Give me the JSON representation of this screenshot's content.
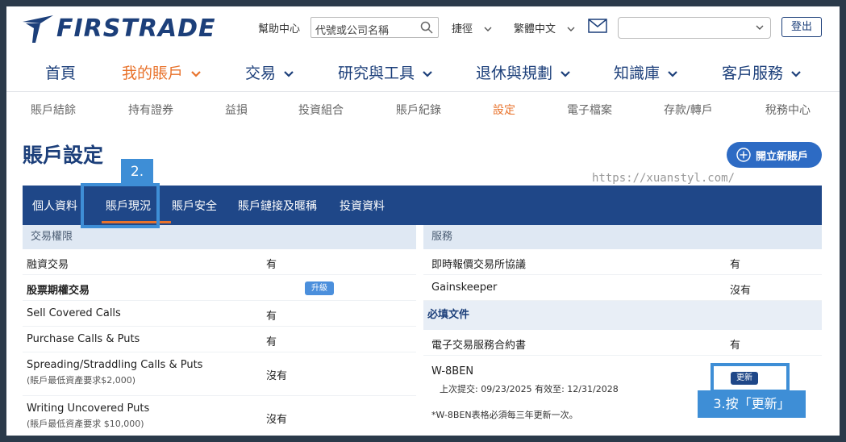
{
  "brand": {
    "logo_text": "FIRSTRADE",
    "color": "#1c3f7a"
  },
  "topbar": {
    "help": "幫助中心",
    "search_placeholder": "代號或公司名稱",
    "quick": "捷徑",
    "language": "繁體中文",
    "account_value": "",
    "logout": "登出"
  },
  "mainnav": [
    {
      "label": "首頁"
    },
    {
      "label": "我的賬戶",
      "active": true
    },
    {
      "label": "交易"
    },
    {
      "label": "研究與工具"
    },
    {
      "label": "退休與規劃"
    },
    {
      "label": "知識庫"
    },
    {
      "label": "客戶服務"
    }
  ],
  "subnav": [
    "賬戶結餘",
    "持有證券",
    "益損",
    "投資組合",
    "賬戶紀錄",
    "設定",
    "電子檔案",
    "存款/轉戶",
    "稅務中心"
  ],
  "subnav_active": "設定",
  "page": {
    "title": "賬戶設定",
    "open_account": "開立新賬戶",
    "watermark": "https://xuanstyl.com/"
  },
  "annotations": {
    "step2": "2.",
    "step3": "3.按「更新」"
  },
  "tabs": [
    "個人資料",
    "賬戶現況",
    "賬戶安全",
    "賬戶鏈接及暱稱",
    "投資資料"
  ],
  "active_tab": "賬戶現況",
  "trading_permissions": {
    "header": "交易權限",
    "rows": [
      {
        "label": "融資交易",
        "value": "有"
      },
      {
        "label": "股票期權交易",
        "value": "",
        "badge": "升級"
      },
      {
        "label": "Sell Covered Calls",
        "value": "有"
      },
      {
        "label": "Purchase Calls & Puts",
        "value": "有"
      },
      {
        "label": "Spreading/Straddling Calls & Puts",
        "note": "(賬戶最低資產要求$2,000)",
        "value": "沒有"
      },
      {
        "label": "Writing Uncovered Puts",
        "note": "(賬戶最低資產要求 $10,000)",
        "value": "沒有"
      }
    ]
  },
  "services": {
    "header": "服務",
    "rows": [
      {
        "label": "即時報價交易所協議",
        "value": "有"
      },
      {
        "label": "Gainskeeper",
        "value": "沒有"
      }
    ]
  },
  "required_docs": {
    "header": "必填文件",
    "rows": [
      {
        "label": "電子交易服務合約書",
        "value": "有"
      }
    ],
    "w8ben": {
      "title": "W-8BEN",
      "dates": "上次提交: 09/23/2025 有效至: 12/31/2028",
      "update": "更新",
      "note": "*W-8BEN表格必須每三年更新一次。"
    }
  },
  "colors": {
    "accent": "#e8722b",
    "nav_blue": "#1f4788",
    "highlight": "#3e8ed6"
  }
}
